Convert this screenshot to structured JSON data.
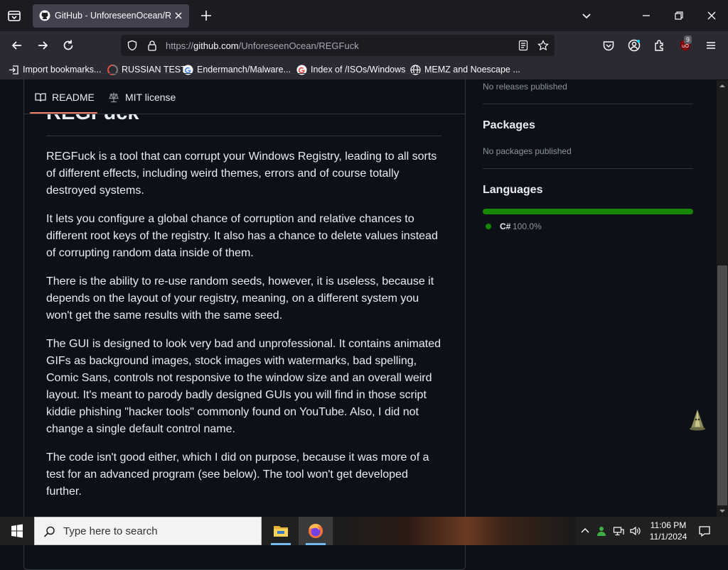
{
  "browser": {
    "tab": {
      "title": "GitHub - UnforeseenOcean/REGFuck"
    },
    "url": {
      "prefix": "https://",
      "host": "github.com",
      "path": "/UnforeseenOcean/REGFuck"
    },
    "extension_badge": "9",
    "bookmarks": [
      {
        "label": "Import bookmarks...",
        "icon": "import-icon"
      },
      {
        "label": "RUSSIAN TEST",
        "icon": "site-icon"
      },
      {
        "label": "Endermanch/Malware...",
        "icon": "google-icon"
      },
      {
        "label": "Index of /ISOs/Windows",
        "icon": "google-icon"
      },
      {
        "label": "MEMZ and Noescape ...",
        "icon": "globe-icon"
      }
    ]
  },
  "readme": {
    "tabs": [
      {
        "label": "README",
        "icon": "book-icon"
      },
      {
        "label": "MIT license",
        "icon": "scale-icon"
      }
    ],
    "title": "REGFuck",
    "paragraphs": [
      "REGFuck is a tool that can corrupt your Windows Registry, leading to all sorts of different effects, including weird themes, errors and of course totally destroyed systems.",
      "It lets you configure a global chance of corruption and relative chances to different root keys of the registry. It also has a chance to delete values instead of corrupting random data inside of them.",
      "There is the ability to re-use random seeds, however, it is useless, because it depends on the layout of your registry, meaning, on a different system you won't get the same results with the same seed.",
      "The GUI is designed to look very bad and unprofessional. It contains animated GIFs as background images, stock images with watermarks, bad spelling, Comic Sans, controls not responsive to the window size and an overall weird layout. It's meant to parody badly designed GUIs you will find in those script kiddie phishing \"hacker tools\" commonly found on YouTube. Also, I did not change a single default control name.",
      "The code isn't good either, which I did on purpose, because it was more of a test for an advanced program (see below). The tool won't get developed further."
    ]
  },
  "sidebar": {
    "releases_text": "No releases published",
    "packages": {
      "heading": "Packages",
      "text": "No packages published"
    },
    "languages": {
      "heading": "Languages",
      "items": [
        {
          "name": "C#",
          "percent": "100.0%",
          "color": "#178600"
        }
      ]
    }
  },
  "taskbar": {
    "search_placeholder": "Type here to search",
    "time": "11:06 PM",
    "date": "11/1/2024"
  },
  "colors": {
    "accent_underline": "#f78166",
    "csharp": "#178600",
    "page_bg": "#0d1117"
  }
}
